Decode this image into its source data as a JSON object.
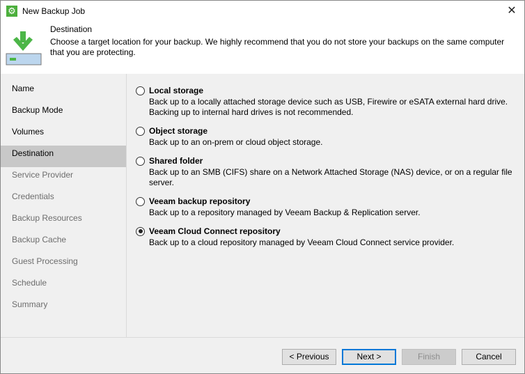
{
  "window": {
    "title": "New Backup Job",
    "close_icon": "close-icon"
  },
  "header": {
    "title": "Destination",
    "description": "Choose a target location for your backup. We highly recommend that you do not store your backups on the same computer that you are protecting."
  },
  "sidebar": {
    "items": [
      {
        "label": "Name"
      },
      {
        "label": "Backup Mode"
      },
      {
        "label": "Volumes"
      },
      {
        "label": "Destination"
      },
      {
        "label": "Service Provider"
      },
      {
        "label": "Credentials"
      },
      {
        "label": "Backup Resources"
      },
      {
        "label": "Backup Cache"
      },
      {
        "label": "Guest Processing"
      },
      {
        "label": "Schedule"
      },
      {
        "label": "Summary"
      }
    ]
  },
  "options": [
    {
      "label": "Local storage",
      "desc": "Back up to a locally attached storage device such as USB, Firewire or eSATA external hard drive. Backing up to internal hard drives is not recommended.",
      "selected": false
    },
    {
      "label": "Object storage",
      "desc": "Back up to an on-prem or cloud object storage.",
      "selected": false
    },
    {
      "label": "Shared folder",
      "desc": "Back up to an SMB (CIFS) share on a Network Attached Storage (NAS) device, or on a regular file server.",
      "selected": false
    },
    {
      "label": "Veeam backup repository",
      "desc": "Back up to a repository managed by Veeam Backup & Replication server.",
      "selected": false
    },
    {
      "label": "Veeam Cloud Connect repository",
      "desc": "Back up to a cloud repository managed by Veeam Cloud Connect service provider.",
      "selected": true
    }
  ],
  "buttons": {
    "previous": "< Previous",
    "next": "Next >",
    "finish": "Finish",
    "cancel": "Cancel"
  },
  "colors": {
    "accent": "#0078d7",
    "icon_green": "#4caf3c"
  }
}
